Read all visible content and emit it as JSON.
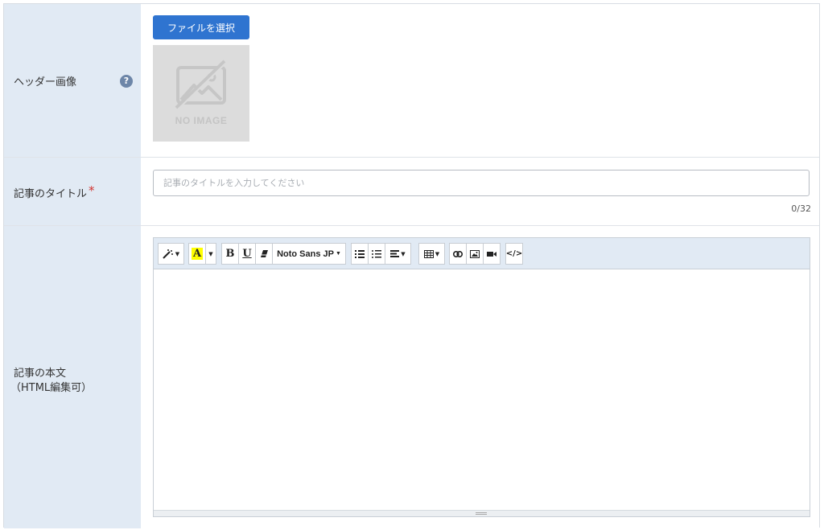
{
  "header_image": {
    "label": "ヘッダー画像",
    "help_glyph": "?",
    "file_button_label": "ファイルを選択",
    "placeholder_image_text": "NO IMAGE"
  },
  "title_field": {
    "label": "記事のタイトル",
    "required_mark": "*",
    "value": "",
    "placeholder": "記事のタイトルを入力してください",
    "counter": "0/32"
  },
  "body_field": {
    "label_line1": "記事の本文",
    "label_line2": "（HTML編集可）",
    "toolbar": {
      "font_name": "Noto Sans JP",
      "bold": "B",
      "underline": "U",
      "color_letter": "A",
      "code_view": "</>"
    },
    "content": ""
  },
  "colors": {
    "label_bg": "#e1eaf4",
    "primary_button": "#2f74d0",
    "required": "#d2342f",
    "help_icon": "#6d86a8"
  }
}
